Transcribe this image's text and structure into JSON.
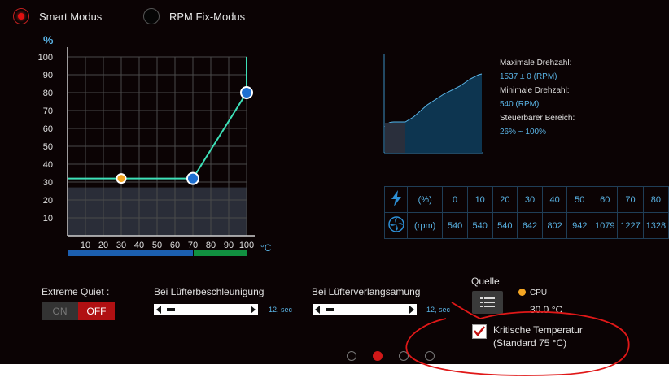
{
  "mode": {
    "smart_label": "Smart Modus",
    "fix_label": "RPM Fix-Modus",
    "selected": "Smart Modus"
  },
  "fan_curve": {
    "y_unit": "%",
    "x_unit": "°C",
    "y_ticks": [
      "100",
      "90",
      "80",
      "70",
      "60",
      "50",
      "40",
      "30",
      "20",
      "10"
    ],
    "x_ticks": [
      "10",
      "20",
      "30",
      "40",
      "50",
      "60",
      "70",
      "80",
      "90",
      "100"
    ],
    "points": [
      {
        "temp": 30,
        "percent": 32,
        "color": "#f5a623"
      },
      {
        "temp": 70,
        "percent": 32,
        "color": "#1e6fd0"
      },
      {
        "temp": 100,
        "percent": 80,
        "color": "#1e6fd0"
      }
    ],
    "min_percent_shaded": 27
  },
  "fan_info": {
    "max_label": "Maximale Drehzahl:",
    "max_value": "1537 ± 0 (RPM)",
    "min_label": "Minimale Drehzahl:",
    "min_value": "540 (RPM)",
    "range_label": "Steuerbarer Bereich:",
    "range_value": "26% ~ 100%"
  },
  "rpm_table": {
    "percent_header": "(%)",
    "rpm_header": "(rpm)",
    "percents": [
      "0",
      "10",
      "20",
      "30",
      "40",
      "50",
      "60",
      "70",
      "80"
    ],
    "rpms": [
      "540",
      "540",
      "540",
      "642",
      "802",
      "942",
      "1079",
      "1227",
      "1328"
    ]
  },
  "extreme_quiet": {
    "label": "Extreme Quiet :",
    "on_label": "ON",
    "off_label": "OFF",
    "state": "OFF"
  },
  "accel": {
    "label": "Bei Lüfterbeschleunigung",
    "value": "12, sec"
  },
  "decel": {
    "label": "Bei Lüfterverlangsamung",
    "value": "12, sec"
  },
  "source": {
    "label": "Quelle",
    "sensor": "CPU",
    "temp": "30.0 °C",
    "sensor_color": "#f5a623"
  },
  "critical": {
    "line1": "Kritische Temperatur",
    "line2": "(Standard 75 °C)",
    "checked": true
  },
  "pager": {
    "count": 4,
    "active": 1
  }
}
